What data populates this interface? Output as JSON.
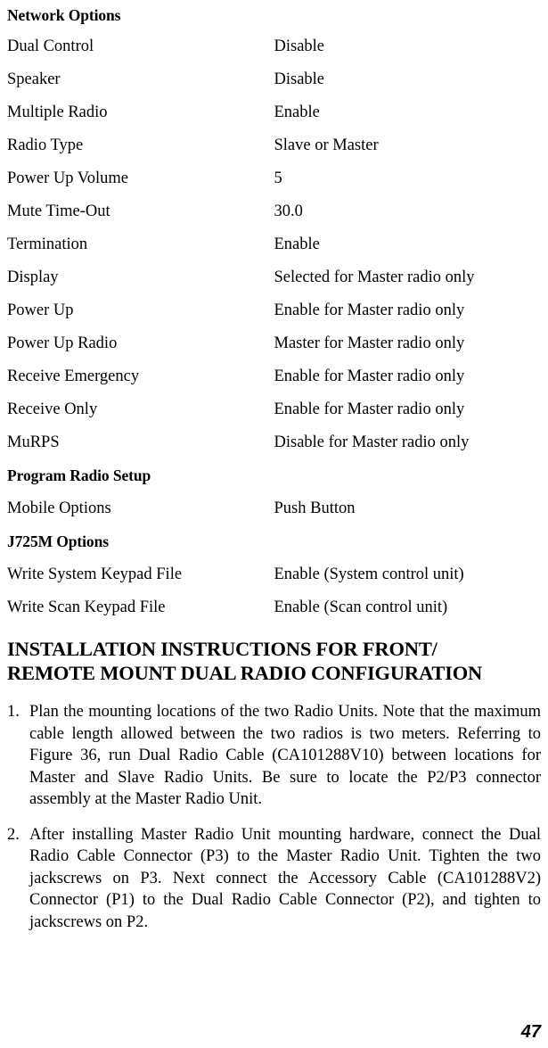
{
  "document": {
    "page_number": "47"
  },
  "settings": {
    "sections": [
      {
        "heading": "Network Options",
        "rows": [
          {
            "label": "Dual Control",
            "value": "Disable"
          },
          {
            "label": "Speaker",
            "value": "Disable"
          },
          {
            "label": "Multiple Radio",
            "value": "Enable"
          },
          {
            "label": "Radio Type",
            "value": "Slave or Master"
          },
          {
            "label": "Power Up Volume",
            "value": "5"
          },
          {
            "label": "Mute Time-Out",
            "value": "30.0"
          },
          {
            "label": "Termination",
            "value": "Enable"
          },
          {
            "label": "Display",
            "value": "Selected for Master radio only"
          },
          {
            "label": "Power Up",
            "value": "Enable for Master radio only"
          },
          {
            "label": "Power Up Radio",
            "value": "Master for Master radio only"
          },
          {
            "label": "Receive Emergency",
            "value": "Enable for Master radio only"
          },
          {
            "label": "Receive Only",
            "value": "Enable for Master radio only"
          },
          {
            "label": "MuRPS",
            "value": "Disable for Master radio only"
          }
        ]
      },
      {
        "heading": "Program Radio Setup",
        "rows": [
          {
            "label": "Mobile Options",
            "value": "Push Button"
          }
        ]
      },
      {
        "heading": "J725M Options",
        "rows": [
          {
            "label": "Write System Keypad File",
            "value": "Enable (System control unit)"
          },
          {
            "label": "Write Scan Keypad File",
            "value": "Enable (Scan control unit)"
          }
        ]
      }
    ]
  },
  "instructions": {
    "heading": "INSTALLATION INSTRUCTIONS FOR FRONT/\nREMOTE MOUNT DUAL RADIO CONFIGURATION",
    "steps": [
      {
        "number": "1.",
        "text": "Plan the mounting locations of the two Radio Units.  Note that the maximum cable length allowed between the two radios is two meters.  Referring to Figure 36, run Dual Radio Cable (CA101288V10) between locations for Master and Slave Radio Units.  Be sure to locate the P2/P3 connector assembly at the Master Radio Unit."
      },
      {
        "number": "2.",
        "text": "After installing Master Radio Unit mounting hardware, connect the Dual Radio Cable Connector (P3) to the Master Radio Unit.  Tighten the two jackscrews on P3.  Next connect the Accessory Cable (CA101288V2) Connector (P1) to the Dual Radio Cable Connector (P2), and tighten to jackscrews on P2."
      }
    ]
  }
}
